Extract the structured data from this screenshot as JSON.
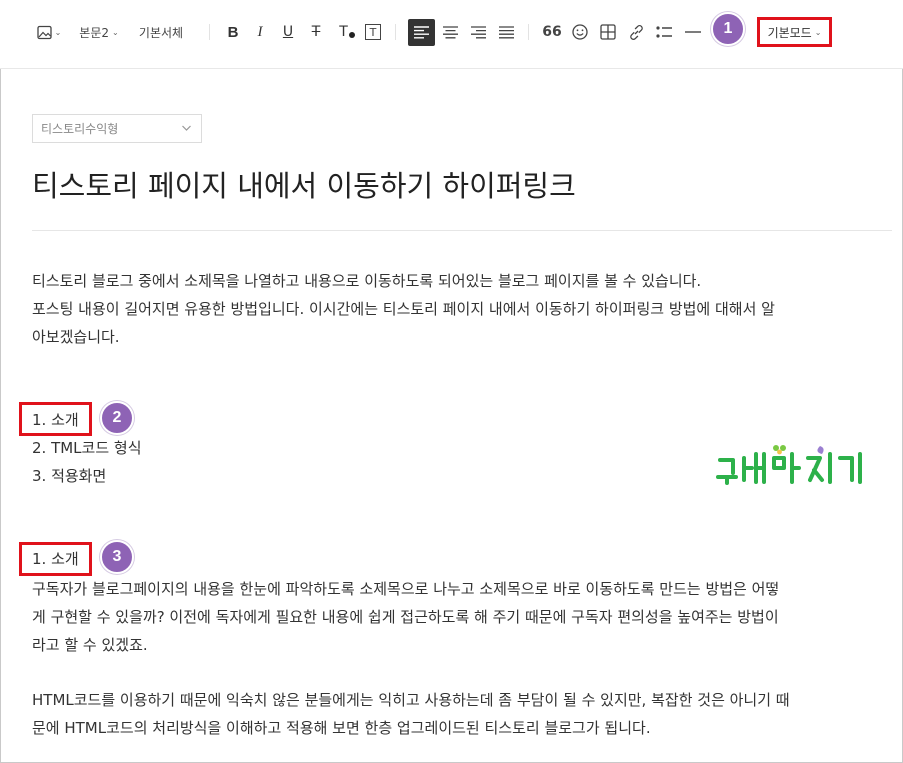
{
  "toolbar": {
    "image_icon": "image-icon",
    "paragraph_style": "본문2",
    "font_family": "기본서체",
    "bold": "B",
    "italic": "I",
    "underline": "U",
    "strike": "T",
    "text_color": "T",
    "text_bg": "T",
    "quote": "66",
    "mode": "기본모드"
  },
  "badges": [
    "1",
    "2",
    "3"
  ],
  "editor": {
    "category": "티스토리수익형",
    "title": "티스토리 페이지 내에서 이동하기 하이퍼링크",
    "intro_line1": "티스토리 블로그 중에서 소제목을 나열하고 내용으로 이동하도록 되어있는 블로그 페이지를 볼 수 있습니다.",
    "intro_line2": "포스팅 내용이 길어지면 유용한 방법입니다. 이시간에는 티스토리 페이지 내에서 이동하기 하이퍼링크 방법에 대해서 알",
    "intro_line3": "아보겠습니다.",
    "toc": [
      "1. 소개",
      "2. TML코드 형식",
      "3. 적용화면"
    ],
    "section_heading": "1. 소개",
    "body1_line1": "구독자가 블로그페이지의 내용을 한눈에 파악하도록 소제목으로 나누고 소제목으로 바로 이동하도록 만드는 방법은 어떻",
    "body1_line2": "게 구현할 수 있을까? 이전에 독자에게 필요한 내용에 쉽게 접근하도록 해 주기 때문에 구독자 편의성을 높여주는 방법이",
    "body1_line3": "라고 할 수 있겠죠.",
    "body2_line1": "HTML코드를 이용하기 때문에 익숙치 않은 분들에게는 익히고 사용하는데 좀 부담이 될 수 있지만, 복잡한 것은 아니기 때",
    "body2_line2": "문에 HTML코드의 처리방식을 이해하고 적용해 보면 한층 업그레이드된 티스토리 블로그가 됩니다."
  },
  "watermark": {
    "text": "컴테마지기",
    "color": "#2db14a"
  },
  "colors": {
    "highlight": "#e0121b",
    "badge": "#8e63b5"
  }
}
